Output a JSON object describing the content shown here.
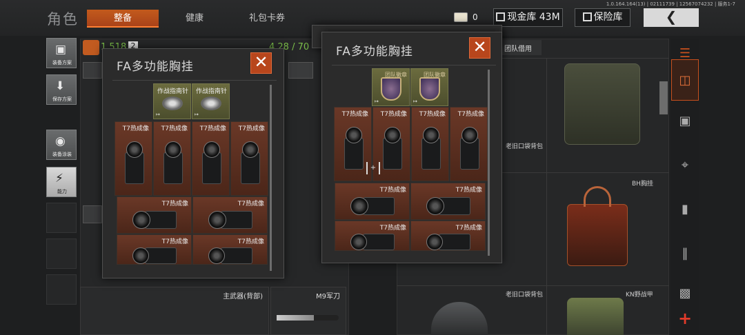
{
  "header": {
    "section_title": "角色",
    "tabs": [
      {
        "label": "整备",
        "active": true
      },
      {
        "label": "健康",
        "active": false
      },
      {
        "label": "礼包卡券",
        "active": false
      }
    ],
    "version": "1.0.164.164(13) | 02111739 | 12567074232 | 服务1-7",
    "ticket_count": "0",
    "cash_vault": "现金库 43M",
    "safe": "保险库",
    "back_icon": "chevron-left-icon"
  },
  "left_menu": [
    {
      "label": "装备方案",
      "icon": "vest-icon"
    },
    {
      "label": "保存方案",
      "icon": "download-icon"
    },
    {
      "label": "装备涂装",
      "icon": "helmet-icon"
    },
    {
      "label": "能力",
      "icon": "lightning-icon"
    }
  ],
  "stats": {
    "value_left": "1,518",
    "value_badge": "2",
    "capacity": "4.28 / 70"
  },
  "background_labels": {
    "primary_weapon": "主武器(背部)",
    "knife": "M9军刀",
    "team_borrow": "团队借用"
  },
  "popup_left": {
    "title": "FA多功能胸挂",
    "badge_items": [
      {
        "name": "作战指南针"
      },
      {
        "name": "作战指南针"
      }
    ],
    "small_items": [
      {
        "name": "T7热成像"
      },
      {
        "name": "T7热成像"
      },
      {
        "name": "T7热成像"
      },
      {
        "name": "T7热成像"
      }
    ],
    "large_items": [
      {
        "name": "T7热成像"
      },
      {
        "name": "T7热成像"
      },
      {
        "name": "T7热成像"
      },
      {
        "name": "T7热成像"
      }
    ]
  },
  "popup_right": {
    "title": "FA多功能胸挂",
    "badge_items": [
      {
        "name": "团队徽章"
      },
      {
        "name": "团队徽章"
      }
    ],
    "small_items": [
      {
        "name": "T7热成像"
      },
      {
        "name": "T7热成像"
      },
      {
        "name": "T7热成像"
      },
      {
        "name": "T7热成像"
      }
    ],
    "large_items": [
      {
        "name": "T7热成像"
      },
      {
        "name": "T7热成像"
      },
      {
        "name": "T7热成像"
      },
      {
        "name": "T7热成像"
      }
    ]
  },
  "shop_items": [
    {
      "name": "老旧口袋背包"
    },
    {
      "name": "BH胸挂"
    },
    {
      "name": "老旧口袋背包"
    },
    {
      "name": "KN野战甲"
    }
  ],
  "right_menu": [
    {
      "icon": "layers-icon"
    },
    {
      "icon": "stack-icon"
    },
    {
      "icon": "bag-icon"
    },
    {
      "icon": "rifle-icon"
    },
    {
      "icon": "magazine-icon"
    },
    {
      "icon": "bullet-icon"
    },
    {
      "icon": "vest-icon"
    },
    {
      "icon": "plus-icon",
      "label": "+"
    }
  ],
  "colors": {
    "accent": "#c8501d",
    "capacity_green": "#7cc04a"
  }
}
